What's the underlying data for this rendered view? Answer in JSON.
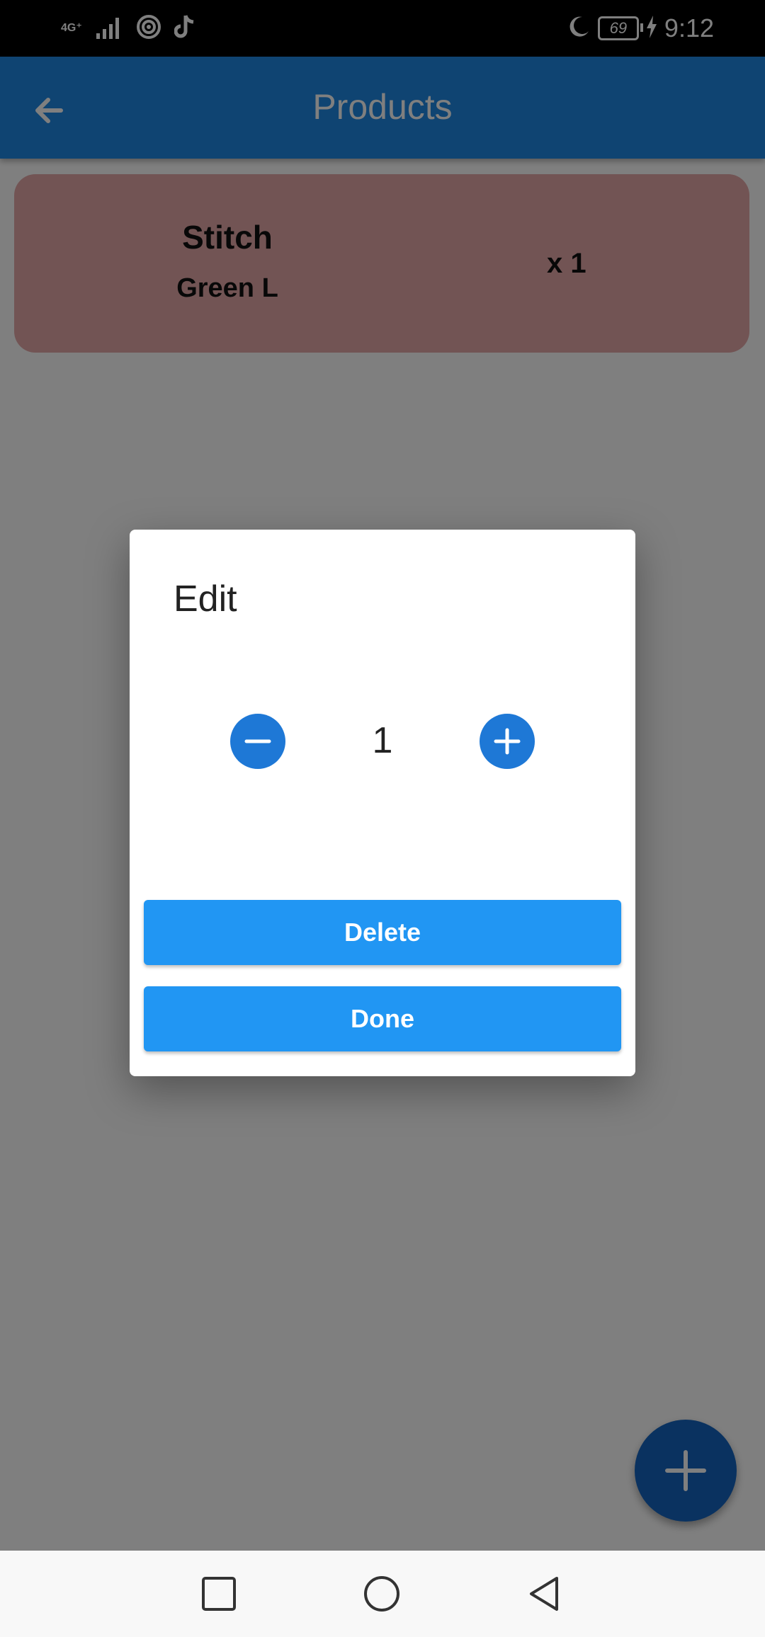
{
  "status_bar": {
    "network": "4G⁺",
    "battery": "69",
    "time": "9:12",
    "icons": [
      "signal-icon",
      "hotspot-icon",
      "tiktok-icon",
      "moon-icon",
      "charging-icon"
    ]
  },
  "app_bar": {
    "title": "Products",
    "back_icon": "arrow-left-icon"
  },
  "product_card": {
    "name": "Stitch",
    "variant": "Green L",
    "quantity": "x 1",
    "color": "#e4a8a8"
  },
  "dialog": {
    "title": "Edit",
    "quantity_value": "1",
    "delete_label": "Delete",
    "done_label": "Done"
  },
  "colors": {
    "app_bar": "#1e88e5",
    "button": "#2196f3",
    "round_button": "#1e78d6",
    "fab": "#1565c0"
  },
  "fab_icon": "plus-icon",
  "nav_bar": {
    "icons": [
      "recent-apps-icon",
      "home-icon",
      "back-icon"
    ]
  }
}
